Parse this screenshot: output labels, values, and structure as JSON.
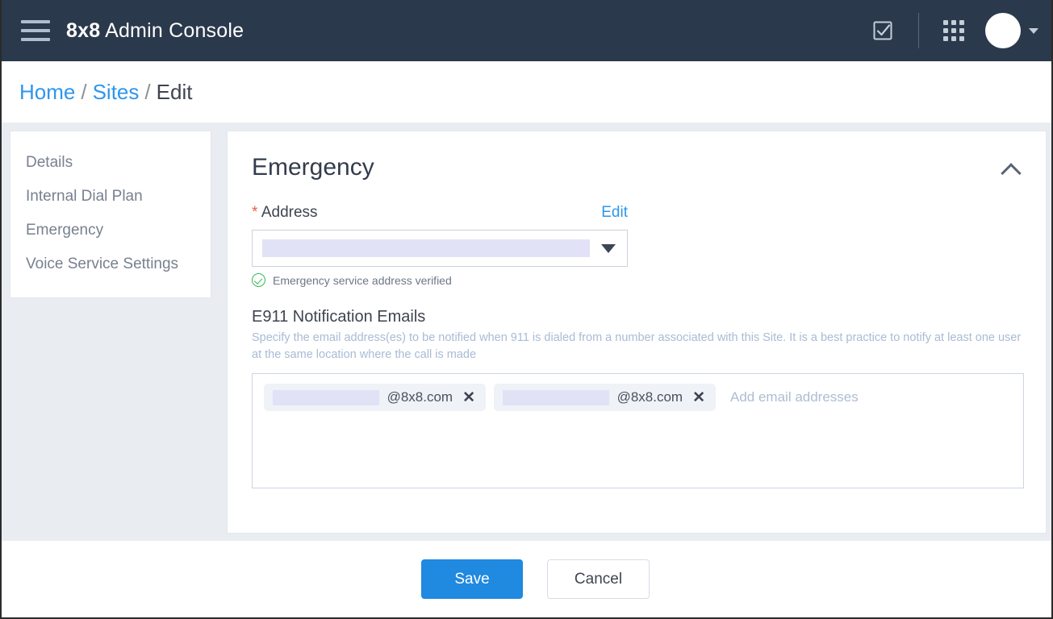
{
  "header": {
    "brand_bold": "8x8",
    "brand_rest": " Admin Console",
    "icons": {
      "menu": "hamburger-menu-icon",
      "tasks": "checkbox-check-icon",
      "apps": "app-grid-icon",
      "avatar": "user-avatar",
      "caret": "chevron-down-icon"
    }
  },
  "breadcrumb": {
    "home": "Home",
    "sep1": "/",
    "sites": "Sites",
    "sep2": "/",
    "current": "Edit"
  },
  "sidebar": {
    "items": [
      {
        "label": "Details"
      },
      {
        "label": "Internal Dial Plan"
      },
      {
        "label": "Emergency"
      },
      {
        "label": "Voice Service Settings"
      }
    ]
  },
  "main": {
    "card_title": "Emergency",
    "collapse_icon": "chevron-up-icon",
    "address": {
      "required_marker": "*",
      "label": "Address",
      "edit_link": "Edit",
      "selected_value": "",
      "value_redacted": true,
      "verified_text": "Emergency service address verified",
      "verified_icon": "check-circle-icon"
    },
    "e911": {
      "title": "E911 Notification Emails",
      "description": "Specify the email address(es) to be notified when 911 is dialed from a number associated with this Site. It is a best practice to notify at least one user at the same location where the call is made",
      "placeholder": "Add email addresses",
      "chips": [
        {
          "user_redacted": true,
          "domain": "@8x8.com",
          "remove_label": "✕"
        },
        {
          "user_redacted": true,
          "domain": "@8x8.com",
          "remove_label": "✕"
        }
      ]
    }
  },
  "footer": {
    "save_label": "Save",
    "cancel_label": "Cancel"
  },
  "colors": {
    "topbar_bg": "#2b394c",
    "accent_blue": "#2089e0",
    "link_blue": "#2e96ec",
    "required_red": "#e8604c",
    "success_green": "#34b759",
    "content_bg": "#e9edf2",
    "redaction": "#e2e2f6"
  }
}
